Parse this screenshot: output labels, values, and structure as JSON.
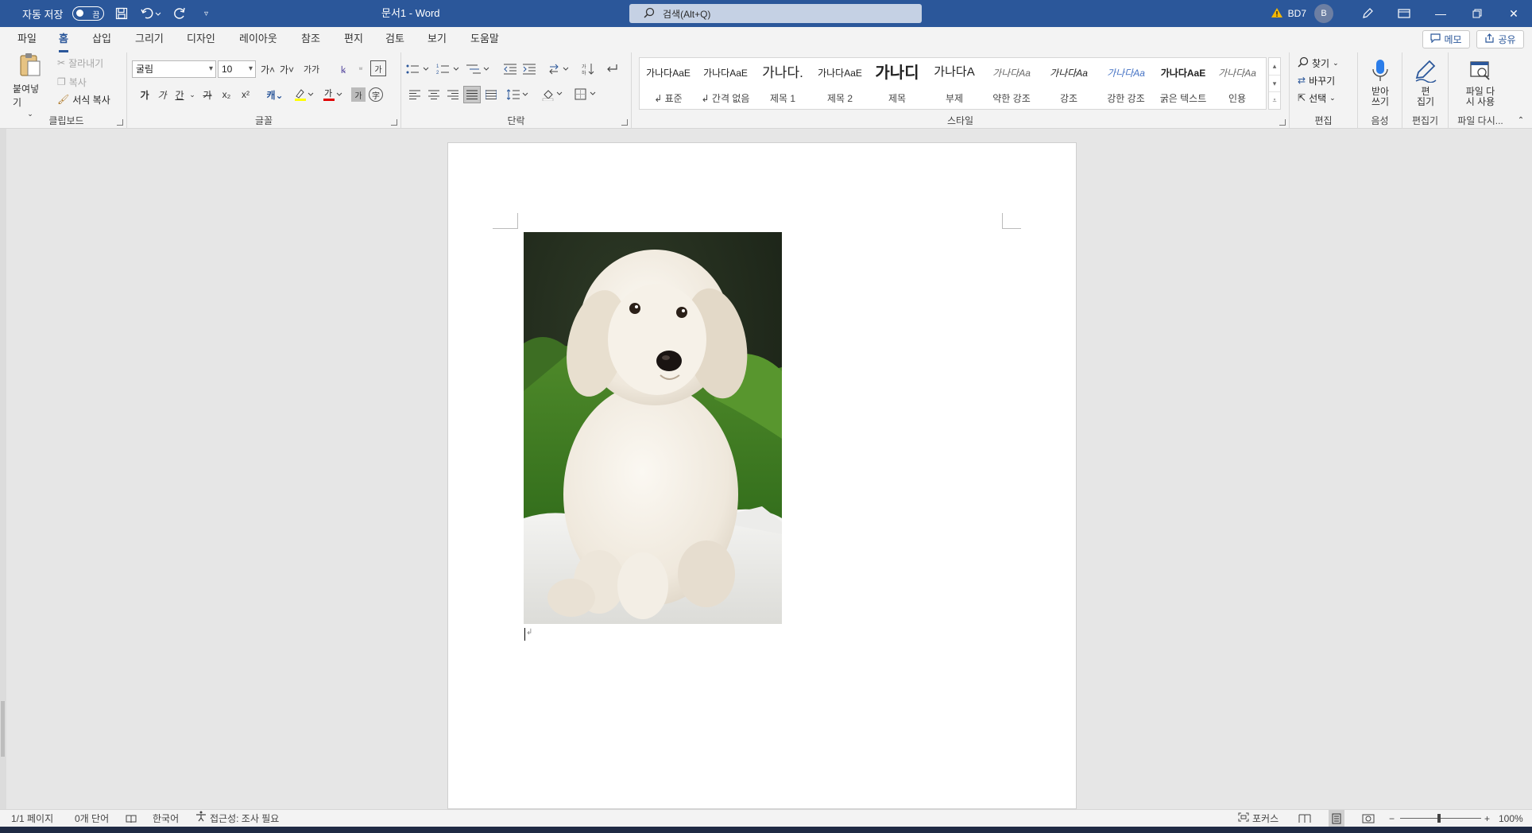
{
  "titlebar": {
    "autosave_label": "자동 저장",
    "autosave_state": "끔",
    "doc_title": "문서1  -  Word",
    "search_placeholder": "검색(Alt+Q)",
    "user_name": "BD7",
    "user_initial": "B"
  },
  "menu": {
    "tabs": [
      "파일",
      "홈",
      "삽입",
      "그리기",
      "디자인",
      "레이아웃",
      "참조",
      "편지",
      "검토",
      "보기",
      "도움말"
    ],
    "active": "홈",
    "memo_label": "메모",
    "share_label": "공유"
  },
  "ribbon": {
    "clipboard": {
      "paste": "붙여넣기",
      "cut": "잘라내기",
      "copy": "복사",
      "format_painter": "서식 복사",
      "group_label": "클립보드"
    },
    "font": {
      "font_name": "굴림",
      "font_size": "10",
      "grow": "가˄",
      "shrink": "가˅",
      "case": "가가",
      "bold": "가",
      "italic": "가",
      "underline": "간",
      "strike": "가",
      "subscript": "x₂",
      "superscript": "x²",
      "group_label": "글꼴"
    },
    "paragraph": {
      "group_label": "단락"
    },
    "styles": {
      "items": [
        {
          "preview": "가나다AaE",
          "name": "↲ 표준"
        },
        {
          "preview": "가나다AaE",
          "name": "↲ 간격 없음"
        },
        {
          "preview": "가나다.",
          "name": "제목 1"
        },
        {
          "preview": "가나다AaE",
          "name": "제목 2"
        },
        {
          "preview": "가나디",
          "name": "제목"
        },
        {
          "preview": "가나다A",
          "name": "부제"
        },
        {
          "preview": "가나다Aa",
          "name": "약한 강조"
        },
        {
          "preview": "가나다Aa",
          "name": "강조"
        },
        {
          "preview": "가나다Aa",
          "name": "강한 강조"
        },
        {
          "preview": "가나다AaE",
          "name": "굵은 텍스트"
        },
        {
          "preview": "가나다Aa",
          "name": "인용"
        }
      ],
      "group_label": "스타일"
    },
    "editing": {
      "find": "찾기",
      "replace": "바꾸기",
      "select": "선택",
      "group_label": "편집"
    },
    "voice": {
      "dictate": "받아\n쓰기",
      "group_label": "음성"
    },
    "editor": {
      "label": "편\n집기",
      "group_label": "편집기"
    },
    "reuse": {
      "label": "파일 다\n시 사용",
      "group_label": "파일 다시..."
    }
  },
  "statusbar": {
    "page": "1/1 페이지",
    "words": "0개 단어",
    "language": "한국어",
    "accessibility": "접근성: 조사 필요",
    "focus": "포커스",
    "zoom": "100%"
  },
  "colors": {
    "title_bg": "#2b579a",
    "accent": "#2b579a",
    "highlight_yellow": "#ffff00",
    "font_red": "#e00000"
  }
}
